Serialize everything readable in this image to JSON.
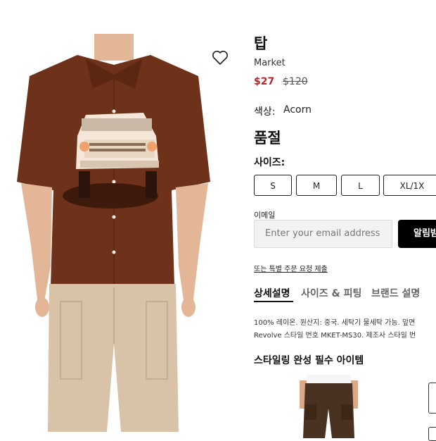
{
  "product": {
    "title": "탑",
    "brand": "Market",
    "sale_price": "$27",
    "original_price": "$120",
    "color_label": "색상:",
    "color_value": "Acorn",
    "sold_out": "품절",
    "size_label": "사이즈:",
    "sizes": [
      "S",
      "M",
      "L",
      "XL/1X"
    ]
  },
  "notify": {
    "email_label": "이메일",
    "email_placeholder": "Enter your email address",
    "button_label": "알림받",
    "special_order_link": "또는 특별 주문 요청 제출"
  },
  "tabs": [
    "상세설명",
    "사이즈 & 피팅",
    "브랜드 설명"
  ],
  "description": {
    "line1": "100% 레이온. 원산지: 중국. 세탁기 물세탁 가능. 앞면",
    "line2": "Revolve 스타일 번호 MKET-MS30. 제조사 스타일 번"
  },
  "styling": {
    "title": "스타일링 완성 필수 아이템"
  },
  "icons": {
    "wishlist": "heart-icon"
  },
  "colors": {
    "sale_price": "#b4252b",
    "shirt": "#6e3119",
    "pants": "#d8c3a8",
    "button": "#000000"
  }
}
